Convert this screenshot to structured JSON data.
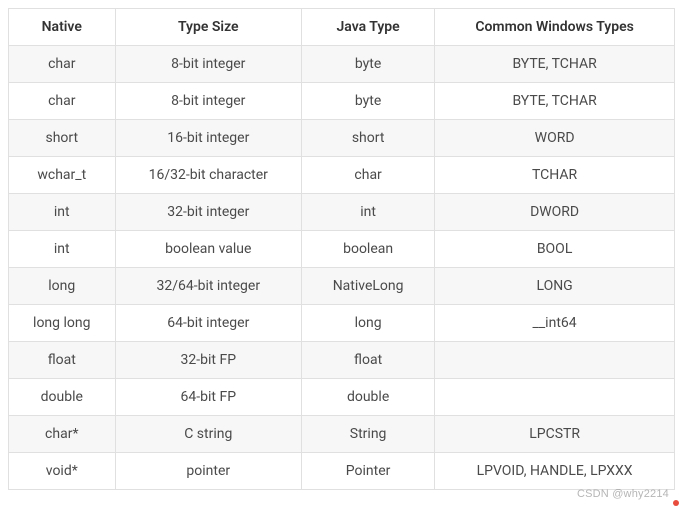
{
  "headers": [
    "Native",
    "Type Size",
    "Java Type",
    "Common Windows Types"
  ],
  "rows": [
    [
      "char",
      "8-bit integer",
      "byte",
      "BYTE, TCHAR"
    ],
    [
      "char",
      "8-bit integer",
      "byte",
      "BYTE, TCHAR"
    ],
    [
      "short",
      "16-bit integer",
      "short",
      "WORD"
    ],
    [
      "wchar_t",
      "16/32-bit character",
      "char",
      "TCHAR"
    ],
    [
      "int",
      "32-bit integer",
      "int",
      "DWORD"
    ],
    [
      "int",
      "boolean value",
      "boolean",
      "BOOL"
    ],
    [
      "long",
      "32/64-bit integer",
      "NativeLong",
      "LONG"
    ],
    [
      "long long",
      "64-bit integer",
      "long",
      "__int64"
    ],
    [
      "float",
      "32-bit FP",
      "float",
      ""
    ],
    [
      "double",
      "64-bit FP",
      "double",
      ""
    ],
    [
      "char*",
      "C string",
      "String",
      "LPCSTR"
    ],
    [
      "void*",
      "pointer",
      "Pointer",
      "LPVOID, HANDLE, LPXXX"
    ]
  ],
  "watermark": "CSDN @why2214"
}
